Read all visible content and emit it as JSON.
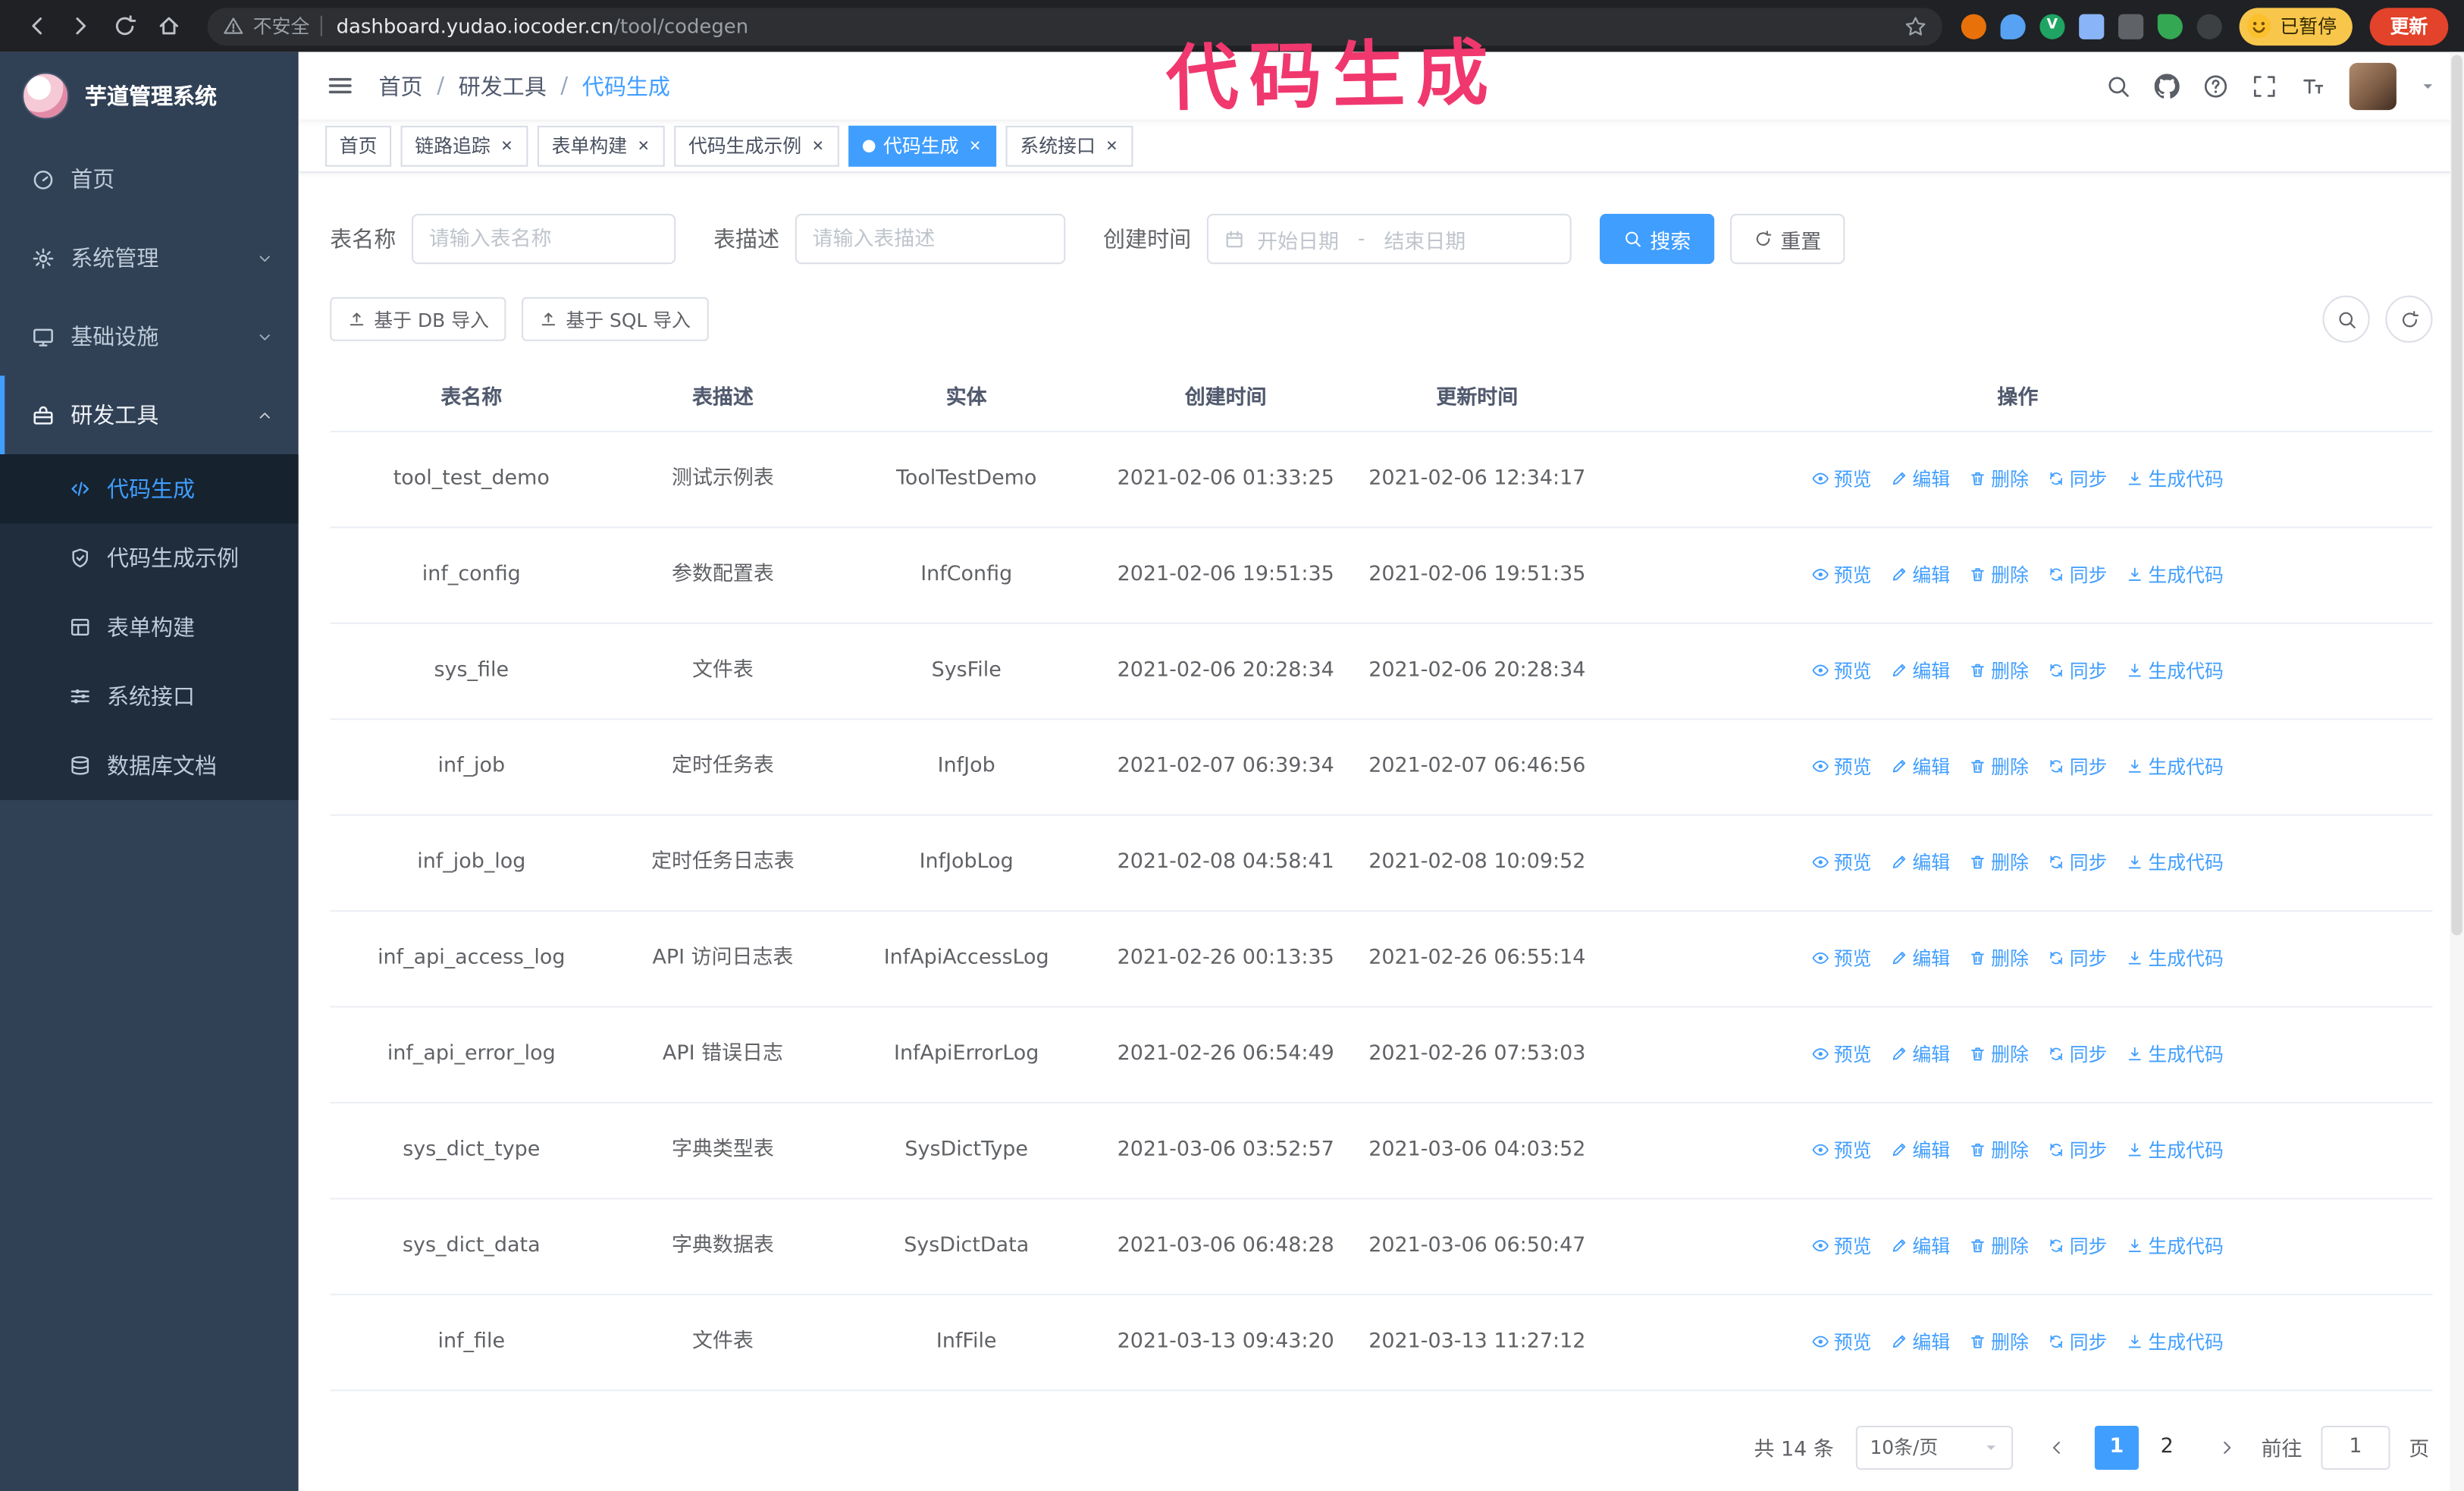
{
  "browser": {
    "security_label": "不安全",
    "url_host": "dashboard.yudao.iocoder.cn",
    "url_path": "/tool/codegen",
    "extension_badge_v": "V",
    "paused_badge": "已暂停",
    "update_button": "更新"
  },
  "annotation": {
    "text": "代码生成",
    "color": "#f0386e"
  },
  "sidebar": {
    "logo_title": "芋道管理系统",
    "items": [
      {
        "label": "首页",
        "icon": "gauge-icon"
      },
      {
        "label": "系统管理",
        "icon": "gear-icon"
      },
      {
        "label": "基础设施",
        "icon": "monitor-icon"
      },
      {
        "label": "研发工具",
        "icon": "toolbox-icon"
      }
    ],
    "submenu": [
      {
        "label": "代码生成",
        "icon": "code-icon",
        "active": true
      },
      {
        "label": "代码生成示例",
        "icon": "shield-icon"
      },
      {
        "label": "表单构建",
        "icon": "form-icon"
      },
      {
        "label": "系统接口",
        "icon": "sliders-icon"
      },
      {
        "label": "数据库文档",
        "icon": "database-icon"
      }
    ]
  },
  "header": {
    "breadcrumb": [
      "首页",
      "研发工具",
      "代码生成"
    ]
  },
  "tabs": [
    {
      "label": "首页",
      "closable": false,
      "active": false
    },
    {
      "label": "链路追踪",
      "closable": true,
      "active": false
    },
    {
      "label": "表单构建",
      "closable": true,
      "active": false
    },
    {
      "label": "代码生成示例",
      "closable": true,
      "active": false
    },
    {
      "label": "代码生成",
      "closable": true,
      "active": true
    },
    {
      "label": "系统接口",
      "closable": true,
      "active": false
    }
  ],
  "filters": {
    "table_name_label": "表名称",
    "table_name_placeholder": "请输入表名称",
    "table_desc_label": "表描述",
    "table_desc_placeholder": "请输入表描述",
    "create_time_label": "创建时间",
    "date_start_placeholder": "开始日期",
    "date_separator": "-",
    "date_end_placeholder": "结束日期",
    "search_button": "搜索",
    "reset_button": "重置"
  },
  "toolbar": {
    "import_db": "基于 DB 导入",
    "import_sql": "基于 SQL 导入"
  },
  "table": {
    "columns": [
      "表名称",
      "表描述",
      "实体",
      "创建时间",
      "更新时间",
      "操作"
    ],
    "actions": [
      "预览",
      "编辑",
      "删除",
      "同步",
      "生成代码"
    ],
    "action_icons": [
      "eye-icon",
      "edit-icon",
      "delete-icon",
      "sync-icon",
      "download-icon"
    ],
    "rows": [
      {
        "name": "tool_test_demo",
        "desc": "测试示例表",
        "entity": "ToolTestDemo",
        "created": "2021-02-06 01:33:25",
        "updated": "2021-02-06 12:34:17"
      },
      {
        "name": "inf_config",
        "desc": "参数配置表",
        "entity": "InfConfig",
        "created": "2021-02-06 19:51:35",
        "updated": "2021-02-06 19:51:35"
      },
      {
        "name": "sys_file",
        "desc": "文件表",
        "entity": "SysFile",
        "created": "2021-02-06 20:28:34",
        "updated": "2021-02-06 20:28:34"
      },
      {
        "name": "inf_job",
        "desc": "定时任务表",
        "entity": "InfJob",
        "created": "2021-02-07 06:39:34",
        "updated": "2021-02-07 06:46:56"
      },
      {
        "name": "inf_job_log",
        "desc": "定时任务日志表",
        "entity": "InfJobLog",
        "created": "2021-02-08 04:58:41",
        "updated": "2021-02-08 10:09:52"
      },
      {
        "name": "inf_api_access_log",
        "desc": "API 访问日志表",
        "entity": "InfApiAccessLog",
        "created": "2021-02-26 00:13:35",
        "updated": "2021-02-26 06:55:14"
      },
      {
        "name": "inf_api_error_log",
        "desc": "API 错误日志",
        "entity": "InfApiErrorLog",
        "created": "2021-02-26 06:54:49",
        "updated": "2021-02-26 07:53:03"
      },
      {
        "name": "sys_dict_type",
        "desc": "字典类型表",
        "entity": "SysDictType",
        "created": "2021-03-06 03:52:57",
        "updated": "2021-03-06 04:03:52"
      },
      {
        "name": "sys_dict_data",
        "desc": "字典数据表",
        "entity": "SysDictData",
        "created": "2021-03-06 06:48:28",
        "updated": "2021-03-06 06:50:47"
      },
      {
        "name": "inf_file",
        "desc": "文件表",
        "entity": "InfFile",
        "created": "2021-03-13 09:43:20",
        "updated": "2021-03-13 11:27:12"
      }
    ]
  },
  "pagination": {
    "total": "共 14 条",
    "page_size": "10条/页",
    "pages": [
      {
        "label": "1",
        "active": true
      },
      {
        "label": "2",
        "active": false
      }
    ],
    "goto_label": "前往",
    "goto_value": "1",
    "goto_suffix": "页"
  }
}
